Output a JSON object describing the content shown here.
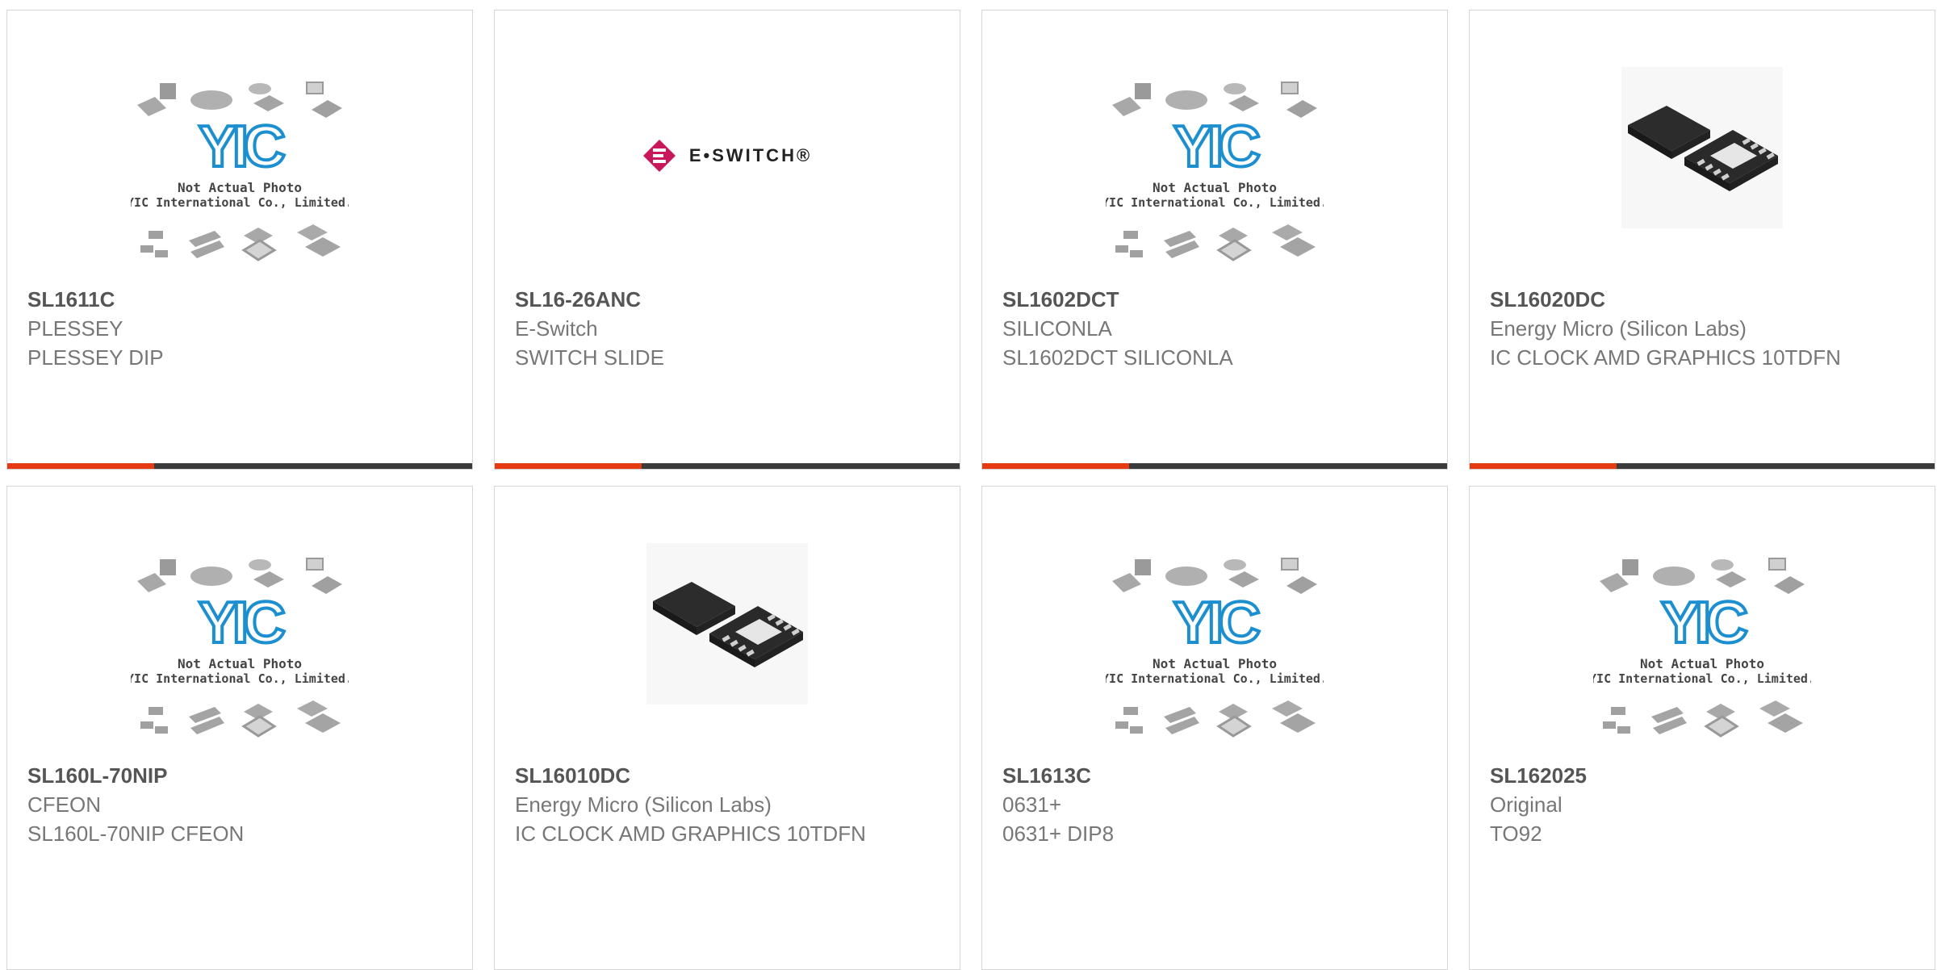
{
  "colors": {
    "accent": "#e63a12",
    "bar": "#3b3b3b",
    "yic_blue": "#1c8fd1",
    "eswitch_red": "#c8185b"
  },
  "cards": [
    {
      "part": "SL1611C",
      "brand": "PLESSEY",
      "desc": "PLESSEY DIP",
      "image": "placeholder",
      "placeholder_lines": [
        "Not Actual Photo",
        "YIC International Co., Limited."
      ]
    },
    {
      "part": "SL16-26ANC",
      "brand": "E-Switch",
      "desc": "SWITCH SLIDE",
      "image": "eswitch-logo",
      "logo_text": "E•SWITCH®"
    },
    {
      "part": "SL1602DCT",
      "brand": "SILICONLA",
      "desc": "SL1602DCT SILICONLA",
      "image": "placeholder",
      "placeholder_lines": [
        "Not Actual Photo",
        "YIC International Co., Limited."
      ]
    },
    {
      "part": "SL16020DC",
      "brand": "Energy Micro (Silicon Labs)",
      "desc": "IC CLOCK AMD GRAPHICS 10TDFN",
      "image": "tdfn-chip"
    },
    {
      "part": "SL160L-70NIP",
      "brand": "CFEON",
      "desc": "SL160L-70NIP CFEON",
      "image": "placeholder",
      "placeholder_lines": [
        "Not Actual Photo",
        "YIC International Co., Limited."
      ]
    },
    {
      "part": "SL16010DC",
      "brand": "Energy Micro (Silicon Labs)",
      "desc": "IC CLOCK AMD GRAPHICS 10TDFN",
      "image": "tdfn-chip"
    },
    {
      "part": "SL1613C",
      "brand": "0631+",
      "desc": "0631+ DIP8",
      "image": "placeholder",
      "placeholder_lines": [
        "Not Actual Photo",
        "YIC International Co., Limited."
      ]
    },
    {
      "part": "SL162025",
      "brand": "Original",
      "desc": "TO92",
      "image": "placeholder",
      "placeholder_lines": [
        "Not Actual Photo",
        "YIC International Co., Limited."
      ]
    }
  ]
}
